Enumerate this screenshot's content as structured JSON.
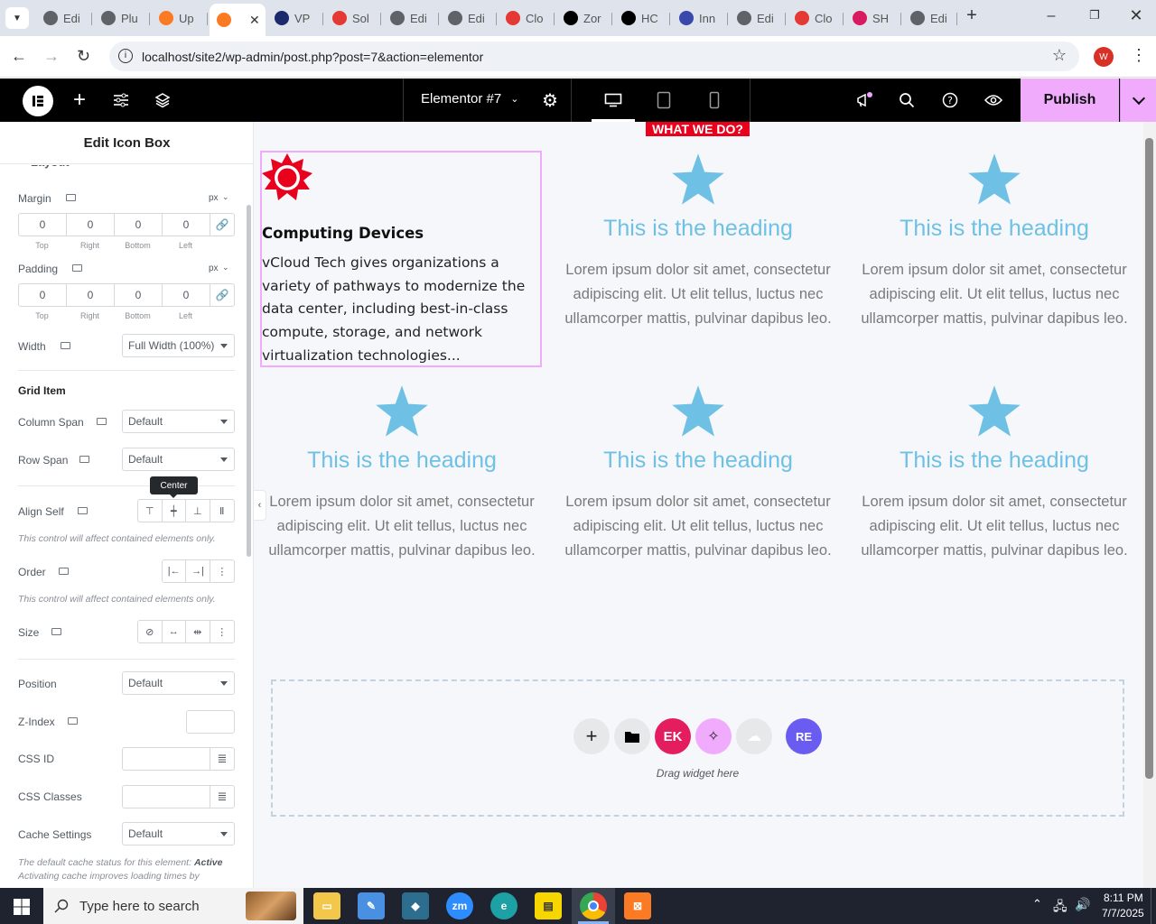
{
  "browser": {
    "tabs": [
      {
        "label": "Edi",
        "color": "#5f6368"
      },
      {
        "label": "Plu",
        "color": "#5f6368"
      },
      {
        "label": "Up",
        "color": "#fb7a24"
      },
      {
        "label": "",
        "color": "#fb7a24"
      },
      {
        "label": "VP",
        "color": "#1a2a6c"
      },
      {
        "label": "Sol",
        "color": "#e53935"
      },
      {
        "label": "Edi",
        "color": "#5f6368"
      },
      {
        "label": "Edi",
        "color": "#5f6368"
      },
      {
        "label": "Clo",
        "color": "#e53935"
      },
      {
        "label": "Zor",
        "color": "#000000"
      },
      {
        "label": "HC",
        "color": "#000000"
      },
      {
        "label": "Inn",
        "color": "#3949ab"
      },
      {
        "label": "Edi",
        "color": "#5f6368"
      },
      {
        "label": "Clo",
        "color": "#e53935"
      },
      {
        "label": "SH",
        "color": "#d81b60"
      },
      {
        "label": "Edi",
        "color": "#5f6368"
      }
    ],
    "url": "localhost/site2/wp-admin/post.php?post=7&action=elementor",
    "profile_initial": "W"
  },
  "topbar": {
    "document_title": "Elementor #7",
    "publish_label": "Publish"
  },
  "panel": {
    "title": "Edit Icon Box",
    "section_cut": "Layout",
    "margin_label": "Margin",
    "margin_unit": "px",
    "margin_values": [
      "0",
      "0",
      "0",
      "0"
    ],
    "padding_label": "Padding",
    "padding_unit": "px",
    "padding_values": [
      "0",
      "0",
      "0",
      "0"
    ],
    "dim_labels": [
      "Top",
      "Right",
      "Bottom",
      "Left"
    ],
    "width_label": "Width",
    "width_value": "Full Width (100%)",
    "grid_item_heading": "Grid Item",
    "column_span_label": "Column Span",
    "column_span_value": "Default",
    "row_span_label": "Row Span",
    "row_span_value": "Default",
    "tooltip": "Center",
    "align_self_label": "Align Self",
    "align_note": "This control will affect contained elements only.",
    "order_label": "Order",
    "order_note": "This control will affect contained elements only.",
    "size_label": "Size",
    "position_label": "Position",
    "position_value": "Default",
    "zindex_label": "Z-Index",
    "cssid_label": "CSS ID",
    "cssclasses_label": "CSS Classes",
    "cache_label": "Cache Settings",
    "cache_value": "Default",
    "cache_note_prefix": "The default cache status for this element: ",
    "cache_note_status": "Active",
    "cache_note_line2": "Activating cache improves loading times by"
  },
  "canvas": {
    "banner": "WHAT WE DO?",
    "selected_box": {
      "heading": "Computing Devices",
      "text": "vCloud Tech gives organizations a variety of pathways to modernize the data center, including best-in-class compute, storage, and network virtualization technologies..."
    },
    "cards": [
      {
        "heading": "This is the heading",
        "text": "Lorem ipsum dolor sit amet, consectetur adipiscing elit. Ut elit tellus, luctus nec ullamcorper mattis, pulvinar dapibus leo."
      },
      {
        "heading": "This is the heading",
        "text": "Lorem ipsum dolor sit amet, consectetur adipiscing elit. Ut elit tellus, luctus nec ullamcorper mattis, pulvinar dapibus leo."
      },
      {
        "heading": "This is the heading",
        "text": "Lorem ipsum dolor sit amet, consectetur adipiscing elit. Ut elit tellus, luctus nec ullamcorper mattis, pulvinar dapibus leo."
      },
      {
        "heading": "This is the heading",
        "text": "Lorem ipsum dolor sit amet, consectetur adipiscing elit. Ut elit tellus, luctus nec ullamcorper mattis, pulvinar dapibus leo."
      },
      {
        "heading": "This is the heading",
        "text": "Lorem ipsum dolor sit amet, consectetur adipiscing elit. Ut elit tellus, luctus nec ullamcorper mattis, pulvinar dapibus leo."
      }
    ],
    "drop_label": "Drag widget here"
  },
  "taskbar": {
    "search_placeholder": "Type here to search",
    "time": "8:11 PM",
    "date": "7/7/2025"
  },
  "colors": {
    "accent_pink": "#e6a8f5",
    "heading_blue": "#6ec1e4",
    "icon_red": "#e8001c"
  }
}
